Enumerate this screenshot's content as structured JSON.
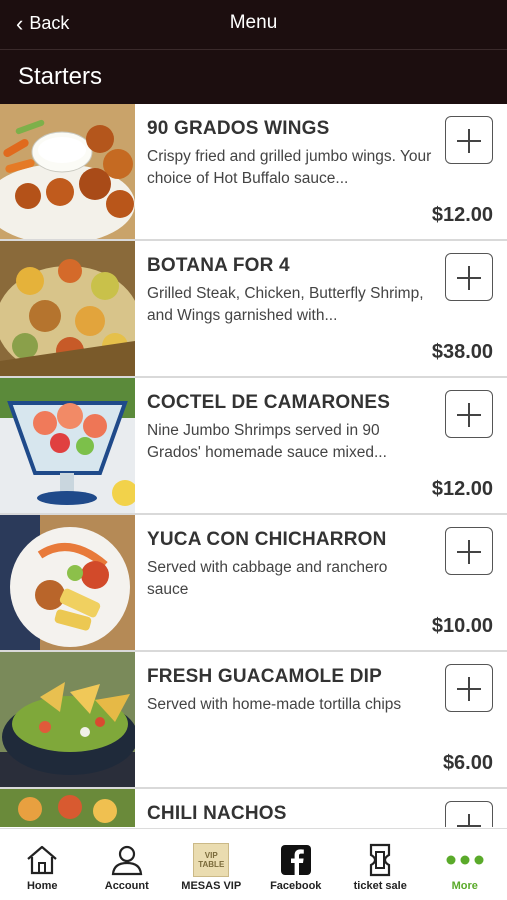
{
  "nav": {
    "back_label": "Back",
    "title": "Menu"
  },
  "section": {
    "title": "Starters"
  },
  "items": [
    {
      "name": "90 GRADOS WINGS",
      "description": "Crispy fried and grilled jumbo wings. Your choice of Hot Buffalo sauce...",
      "price": "$12.00"
    },
    {
      "name": "BOTANA FOR 4",
      "description": "Grilled Steak, Chicken, Butterfly Shrimp, and Wings garnished with...",
      "price": "$38.00"
    },
    {
      "name": "COCTEL DE CAMARONES",
      "description": "Nine Jumbo Shrimps served in 90 Grados' homemade sauce mixed...",
      "price": "$12.00"
    },
    {
      "name": "YUCA CON CHICHARRON",
      "description": "Served with cabbage and ranchero sauce",
      "price": "$10.00"
    },
    {
      "name": "FRESH GUACAMOLE DIP",
      "description": "Served with home-made tortilla chips",
      "price": "$6.00"
    },
    {
      "name": "CHILI NACHOS",
      "description": "",
      "price": ""
    }
  ],
  "tabs": [
    {
      "label": "Home",
      "icon": "home-icon"
    },
    {
      "label": "Account",
      "icon": "account-icon"
    },
    {
      "label": "MESAS VIP",
      "icon": "vip-table-icon",
      "badge_text": "VIP TABLE"
    },
    {
      "label": "Facebook",
      "icon": "facebook-icon"
    },
    {
      "label": "ticket sale",
      "icon": "ticket-icon"
    },
    {
      "label": "More",
      "icon": "more-icon"
    }
  ],
  "colors": {
    "header_bg": "#1c0e0f",
    "more_accent": "#5aaa2a"
  }
}
